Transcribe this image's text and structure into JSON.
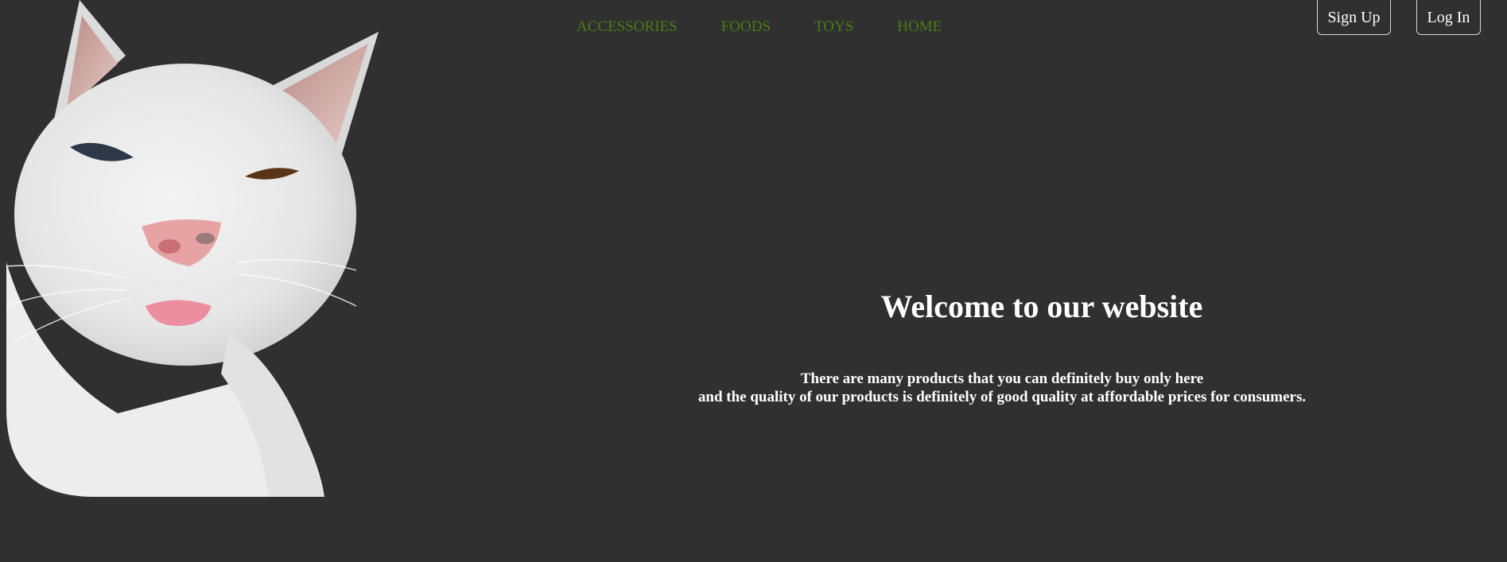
{
  "nav": {
    "items": [
      {
        "label": "ACCESSORIES"
      },
      {
        "label": "FOODS"
      },
      {
        "label": "TOYS"
      },
      {
        "label": "HOME"
      }
    ],
    "link_color": "#4a7d12"
  },
  "auth": {
    "signup_label": "Sign Up",
    "login_label": "Log In"
  },
  "hero": {
    "title": "Welcome to our website",
    "line1": "There are many products that you can definitely buy only here",
    "line2": "and the quality of our products is definitely of good quality at affordable prices for consumers."
  },
  "colors": {
    "background": "#303030",
    "text": "#ffffff"
  },
  "image": {
    "icon": "white-cat-photo"
  }
}
